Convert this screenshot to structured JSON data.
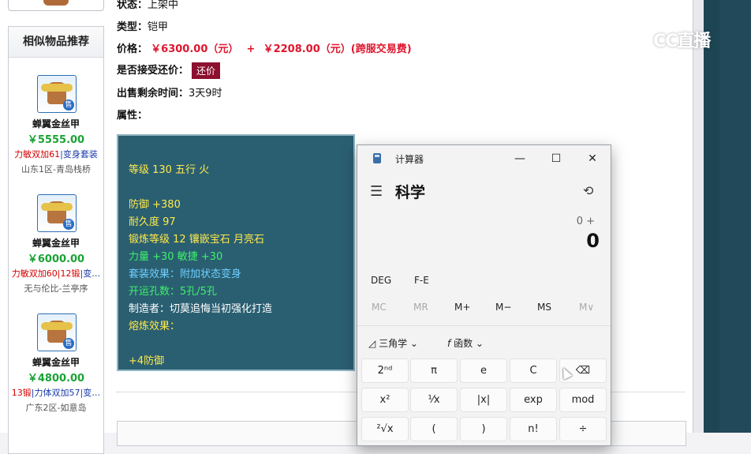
{
  "sidebar": {
    "title": "相似物品推荐",
    "items": [
      {
        "name": "蝉翼金丝甲",
        "price": "￥5555.00",
        "tag_red": "力敏双加61",
        "tag_sep": "|",
        "tag_blue": "变身套装",
        "server": "山东1区-青岛栈桥"
      },
      {
        "name": "蝉翼金丝甲",
        "price": "￥6000.00",
        "tag_red": "力敏双加60|12锻",
        "tag_sep": "|",
        "tag_blue": "变…",
        "server": "无与伦比-兰亭序"
      },
      {
        "name": "蝉翼金丝甲",
        "price": "￥4800.00",
        "tag_red": "13锻",
        "tag_sep": "|",
        "tag_blue": "力体双加57|变…",
        "server": "广东2区-如意岛"
      }
    ],
    "sale_badge": "售"
  },
  "details": {
    "status_label": "状态：",
    "status_value": "上架中",
    "type_label": "类型：",
    "type_value": "铠甲",
    "price_label": "价格：",
    "price_value": "￥6300.00（元）",
    "price_plus": "+",
    "price_fee": "￥2208.00（元）(跨服交易费)",
    "counter_label": "是否接受还价：",
    "counter_button": "还价",
    "time_label": "出售剩余时间：",
    "time_value": "3天9时",
    "attr_label": "属性："
  },
  "attributes": {
    "level": "等级 130 五行 火",
    "defense": "防御 +380",
    "durability": "耐久度 97",
    "forge": "锻炼等级 12 镶嵌宝石 月亮石",
    "stats": "力量 +30 敏捷 +30",
    "set_effect": "套装效果：附加状态变身",
    "slots": "开运孔数：5孔/5孔",
    "maker": "制造者：切莫追悔当初强化打造",
    "melt": "熔炼效果：",
    "bonus": "+4防御"
  },
  "watermark": "CC直播",
  "calculator": {
    "title": "计算器",
    "mode": "科学",
    "expression": "0 +",
    "result": "0",
    "angle": "DEG",
    "fe": "F-E",
    "memory": [
      "MC",
      "MR",
      "M+",
      "M−",
      "MS",
      "M∨"
    ],
    "trig": "三角学",
    "func": "函数",
    "keys_row1": [
      "2ⁿᵈ",
      "π",
      "e",
      "C",
      "⌫"
    ],
    "keys_row2": [
      "x²",
      "¹⁄x",
      "|x|",
      "exp",
      "mod"
    ],
    "keys_row3": [
      "²√x",
      "(",
      ")",
      "n!",
      "÷"
    ]
  },
  "colors": {
    "price_red": "#e0152d",
    "green": "#1aa336",
    "attr_bg": "#2a5f72",
    "attr_yellow": "#ffe94a",
    "attr_green": "#3ff06a",
    "attr_cyan": "#6fd0ff",
    "button_maroon": "#8c1030"
  }
}
